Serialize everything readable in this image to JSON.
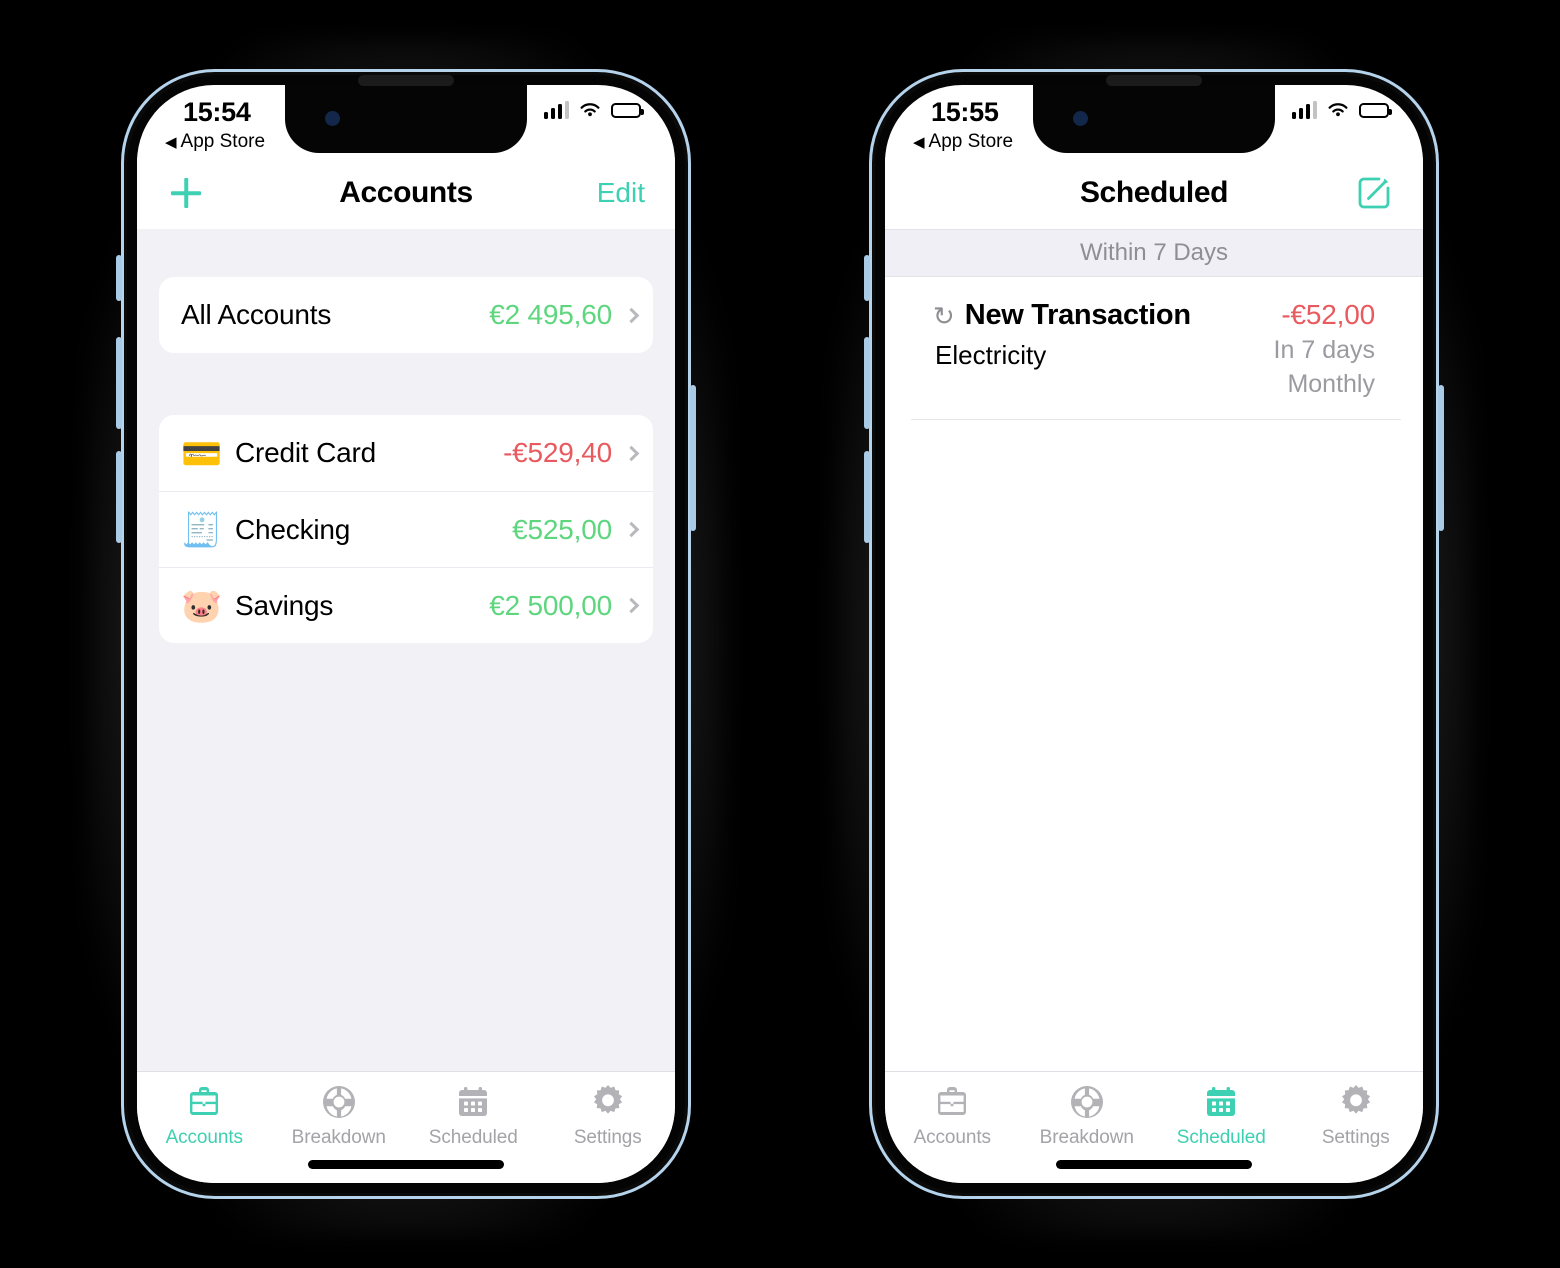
{
  "phones": [
    {
      "id": "accounts-phone",
      "status_bar": {
        "time": "15:54",
        "back_label": "App Store",
        "back_arrow": "◀",
        "signal_icon": "cellular-signal-icon",
        "wifi_icon": "wifi-icon",
        "battery_icon": "battery-icon"
      },
      "nav": {
        "title": "Accounts",
        "left_action": "+",
        "left_action_name": "add-icon",
        "right_action": "Edit"
      },
      "summary": {
        "label": "All Accounts",
        "amount": "€2 495,60",
        "amount_sign": "positive"
      },
      "accounts": [
        {
          "emoji": "💳",
          "icon_name": "credit-card-emoji",
          "label": "Credit Card",
          "amount": "-€529,40",
          "amount_sign": "negative"
        },
        {
          "emoji": "🧾",
          "icon_name": "cheque-emoji",
          "label": "Checking",
          "amount": "€525,00",
          "amount_sign": "positive"
        },
        {
          "emoji": "🐷",
          "icon_name": "piggy-bank-emoji",
          "label": "Savings",
          "amount": "€2 500,00",
          "amount_sign": "positive"
        }
      ],
      "tabs": [
        {
          "label": "Accounts",
          "icon": "briefcase-icon",
          "active": true
        },
        {
          "label": "Breakdown",
          "icon": "pie-chart-icon",
          "active": false
        },
        {
          "label": "Scheduled",
          "icon": "calendar-icon",
          "active": false
        },
        {
          "label": "Settings",
          "icon": "gear-icon",
          "active": false
        }
      ]
    },
    {
      "id": "scheduled-phone",
      "status_bar": {
        "time": "15:55",
        "back_label": "App Store",
        "back_arrow": "◀",
        "signal_icon": "cellular-signal-icon",
        "wifi_icon": "wifi-icon",
        "battery_icon": "battery-icon"
      },
      "nav": {
        "title": "Scheduled",
        "right_action_name": "compose-icon"
      },
      "section_header": "Within 7 Days",
      "transactions": [
        {
          "repeat_icon": "↺",
          "title": "New Transaction",
          "subtitle": "Electricity",
          "amount": "-€52,00",
          "when": "In 7 days",
          "frequency": "Monthly"
        }
      ],
      "tabs": [
        {
          "label": "Accounts",
          "icon": "briefcase-icon",
          "active": false
        },
        {
          "label": "Breakdown",
          "icon": "pie-chart-icon",
          "active": false
        },
        {
          "label": "Scheduled",
          "icon": "calendar-icon",
          "active": true
        },
        {
          "label": "Settings",
          "icon": "gear-icon",
          "active": false
        }
      ]
    }
  ],
  "colors": {
    "accent": "#3ed0b2",
    "positive": "#5ed67e",
    "negative": "#e85a5f",
    "muted": "#8e8e93",
    "screen_bg": "#f2f1f6",
    "bezel": "#b6d3ec"
  }
}
